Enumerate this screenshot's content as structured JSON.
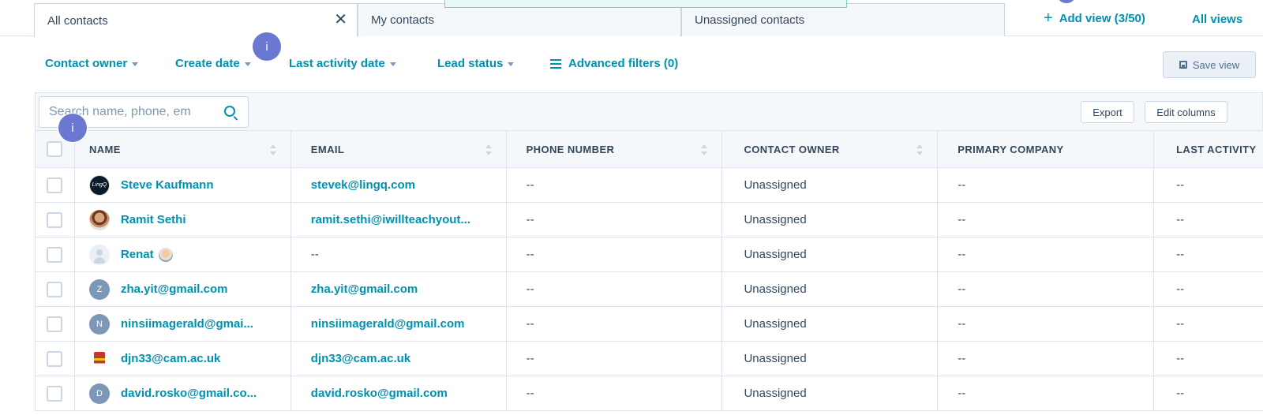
{
  "tabs": [
    {
      "label": "All contacts",
      "active": true,
      "close_glyph": "✕"
    },
    {
      "label": "My contacts",
      "active": false
    },
    {
      "label": "Unassigned contacts",
      "active": false
    }
  ],
  "tab_actions": {
    "add_view_icon": "plus-icon",
    "add_view_label": "Add view (3/50)",
    "all_views_label": "All views"
  },
  "filters": {
    "contact_owner": "Contact owner",
    "create_date": "Create date",
    "last_activity_date": "Last activity date",
    "lead_status": "Lead status",
    "advanced_filters": "Advanced filters (0)",
    "save_view": "Save view"
  },
  "info_badge": "i",
  "toolbar": {
    "search_placeholder": "Search name, phone, em",
    "export_label": "Export",
    "edit_columns_label": "Edit columns"
  },
  "table": {
    "columns": [
      "NAME",
      "EMAIL",
      "PHONE NUMBER",
      "CONTACT OWNER",
      "PRIMARY COMPANY",
      "LAST ACTIVITY"
    ],
    "rows": [
      {
        "avatar": "lingq-logo",
        "avatar_text": "LingQ",
        "name": "Steve Kaufmann",
        "email": "stevek@lingq.com",
        "phone": "--",
        "owner": "Unassigned",
        "company": "--",
        "last_activity": "--"
      },
      {
        "avatar": "photo",
        "avatar_text": "",
        "name": "Ramit Sethi",
        "email": "ramit.sethi@iwillteachyout...",
        "phone": "--",
        "owner": "Unassigned",
        "company": "--",
        "last_activity": "--"
      },
      {
        "avatar": "default",
        "avatar_text": "",
        "name": "Renat",
        "email": "--",
        "phone": "--",
        "owner": "Unassigned",
        "company": "--",
        "last_activity": "--"
      },
      {
        "avatar": "letter",
        "avatar_text": "Z",
        "name": "zha.yit@gmail.com",
        "email": "zha.yit@gmail.com",
        "phone": "--",
        "owner": "Unassigned",
        "company": "--",
        "last_activity": "--"
      },
      {
        "avatar": "letter",
        "avatar_text": "N",
        "name": "ninsiimagerald@gmai...",
        "email": "ninsiimagerald@gmail.com",
        "phone": "--",
        "owner": "Unassigned",
        "company": "--",
        "last_activity": "--"
      },
      {
        "avatar": "crest",
        "avatar_text": "",
        "name": "djn33@cam.ac.uk",
        "email": "djn33@cam.ac.uk",
        "phone": "--",
        "owner": "Unassigned",
        "company": "--",
        "last_activity": "--"
      },
      {
        "avatar": "letter",
        "avatar_text": "D",
        "name": "david.rosko@gmail.co...",
        "email": "david.rosko@gmail.com",
        "phone": "--",
        "owner": "Unassigned",
        "company": "--",
        "last_activity": "--"
      }
    ]
  },
  "colors": {
    "link": "#0091ae",
    "text": "#33475b",
    "border": "#dfe3eb",
    "badge": "#6a78d1"
  }
}
